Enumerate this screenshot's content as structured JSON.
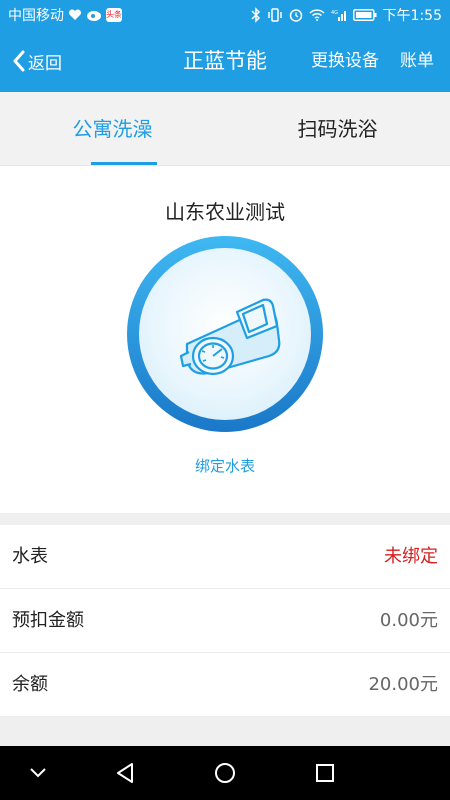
{
  "status_bar": {
    "carrier": "中国移动",
    "time": "下午1:55",
    "badge_text": "头条",
    "network": "4G"
  },
  "header": {
    "back_label": "返回",
    "title": "正蓝节能",
    "change_device_label": "更换设备",
    "bill_label": "账单"
  },
  "tabs": [
    {
      "label": "公寓洗澡",
      "active": true
    },
    {
      "label": "扫码洗浴",
      "active": false
    }
  ],
  "main": {
    "org_name": "山东农业测试",
    "bind_link": "绑定水表",
    "meter_icon": "water-meter-icon"
  },
  "info": [
    {
      "label": "水表",
      "value": "未绑定",
      "alert": true
    },
    {
      "label": "预扣金额",
      "value": "0.00元",
      "alert": false
    },
    {
      "label": "余额",
      "value": "20.00元",
      "alert": false
    }
  ],
  "colors": {
    "accent": "#1f9ee3",
    "alert": "#d81e1e"
  }
}
